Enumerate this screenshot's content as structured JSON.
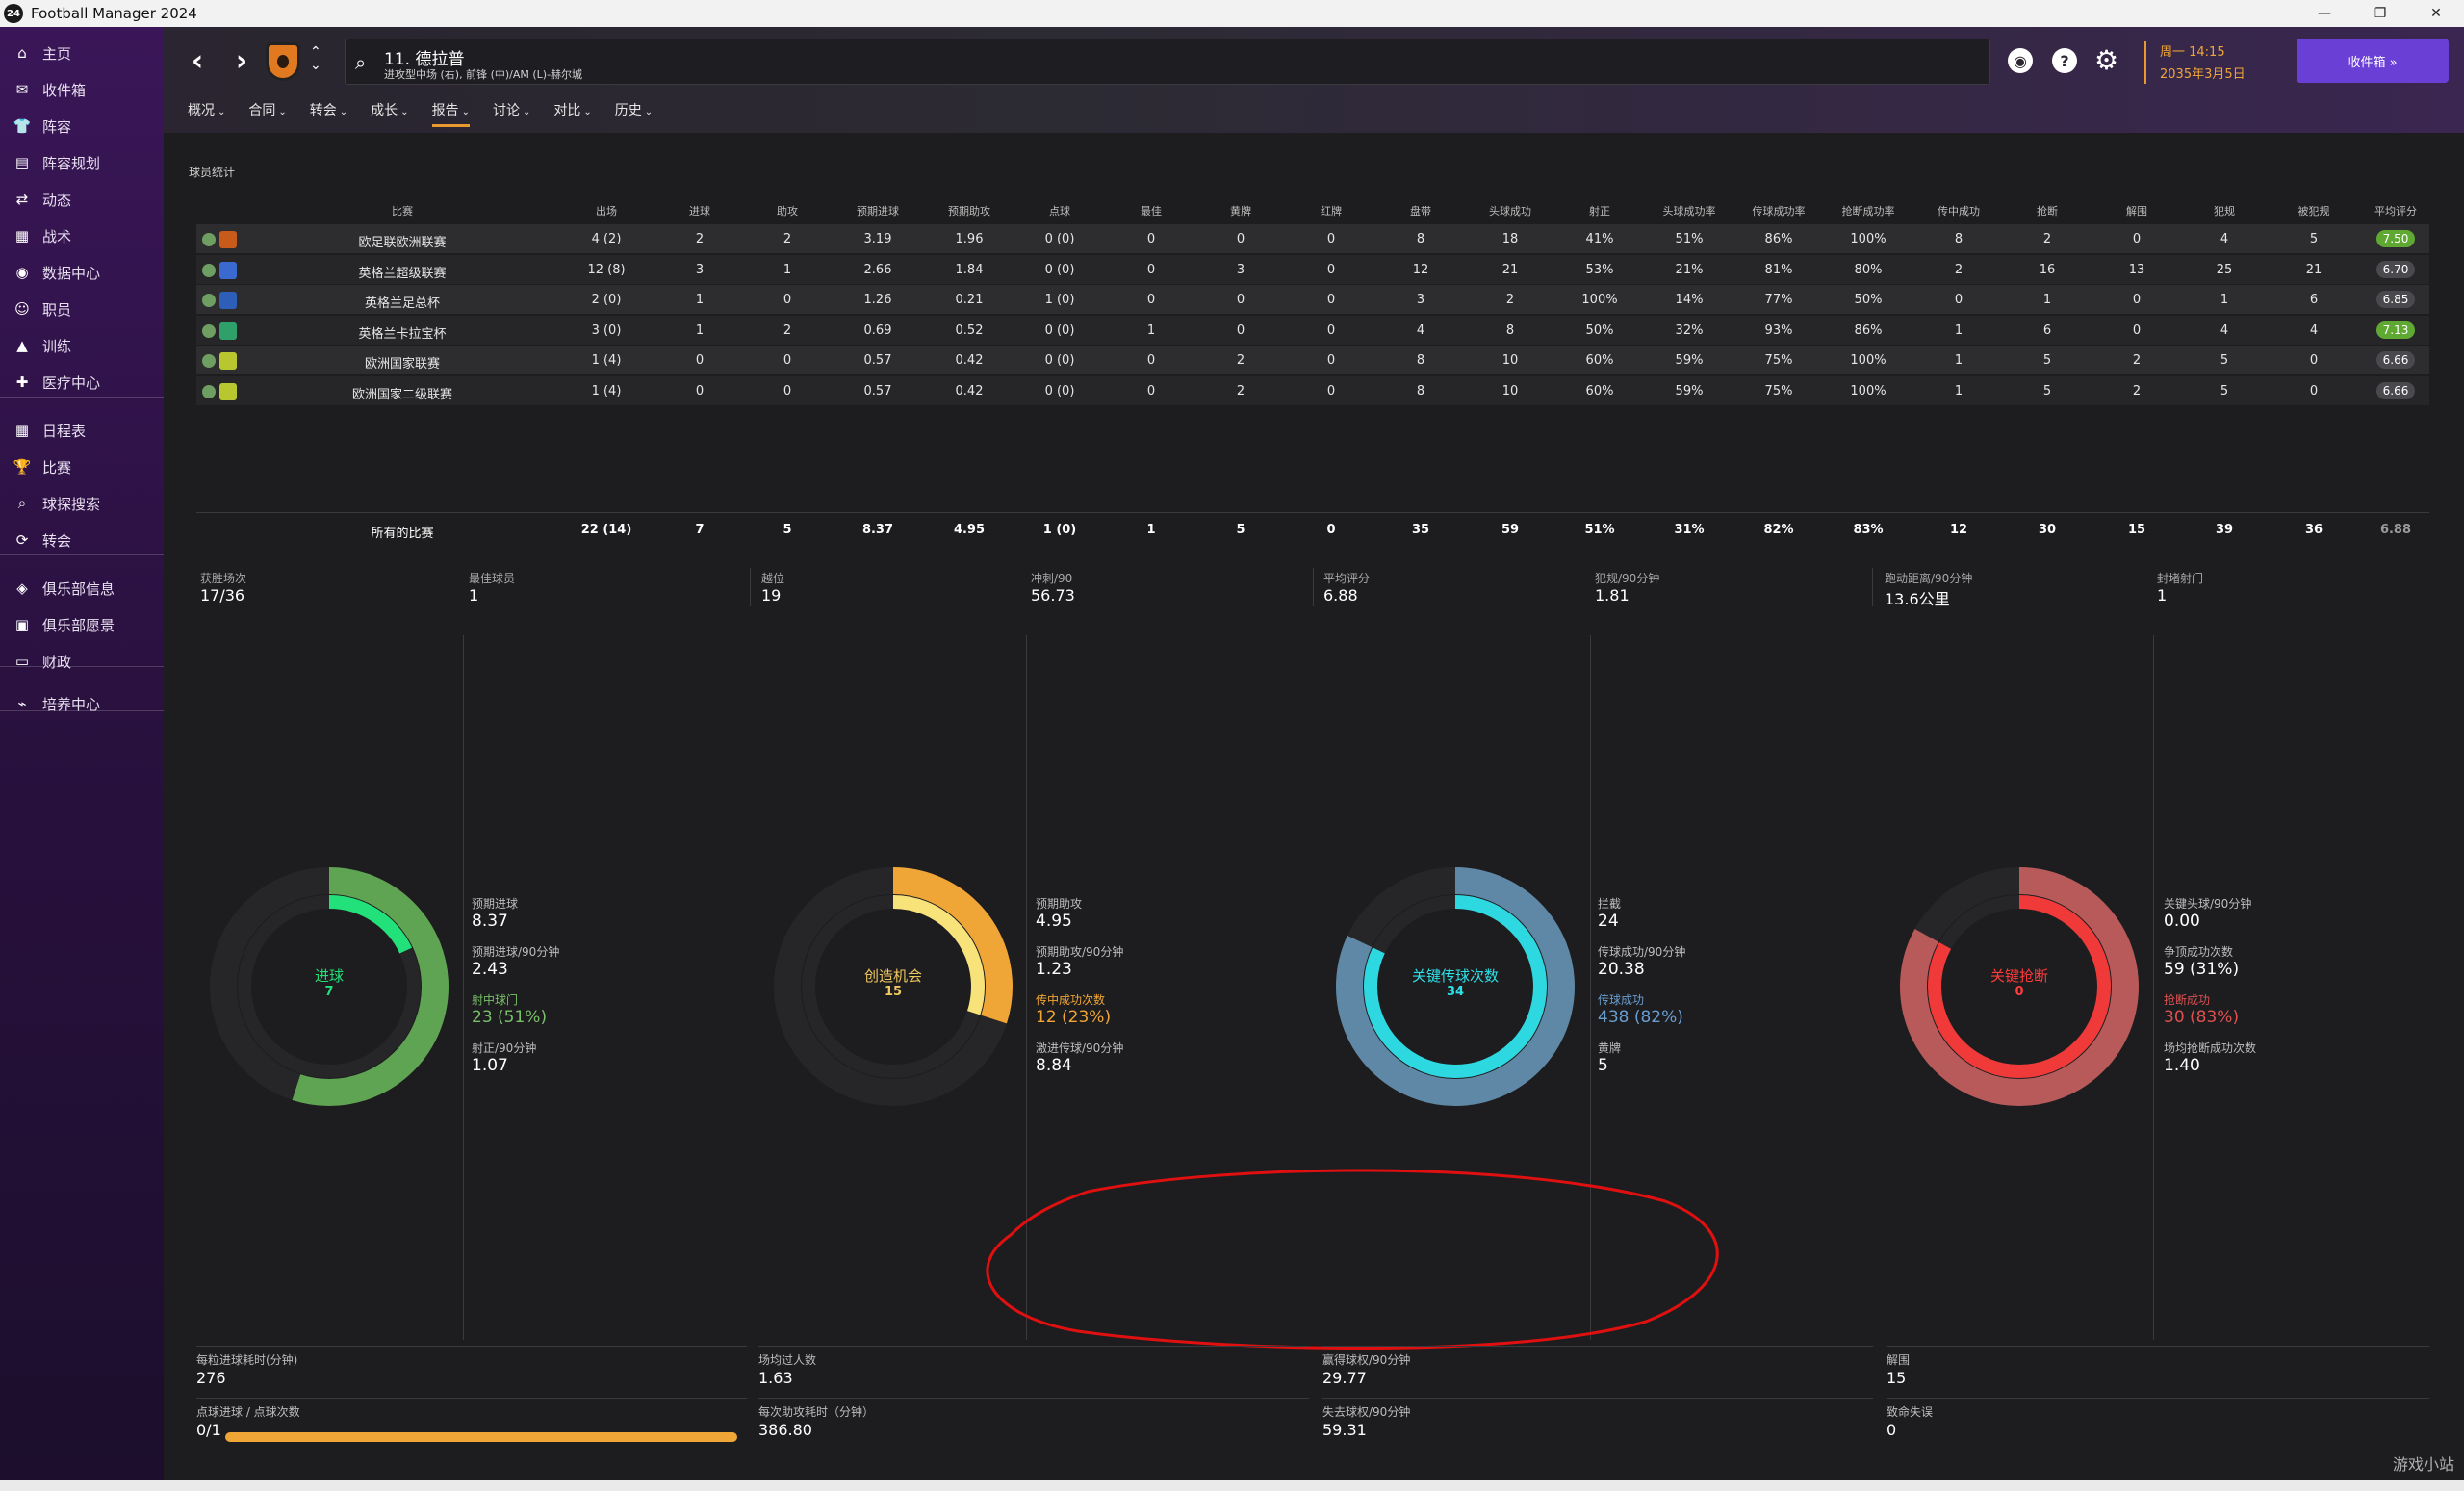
{
  "window": {
    "app_icon": "24",
    "title": "Football Manager 2024",
    "minimize": "—",
    "restore": "❐",
    "close": "✕"
  },
  "sidebar": {
    "items": [
      {
        "label": "主页",
        "icon": "home-icon",
        "glyph": "⌂"
      },
      {
        "label": "收件箱",
        "icon": "inbox-icon",
        "glyph": "✉"
      },
      {
        "label": "阵容",
        "icon": "shirt-icon",
        "glyph": "👕"
      },
      {
        "label": "阵容规划",
        "icon": "clipboard-icon",
        "glyph": "▤"
      },
      {
        "label": "动态",
        "icon": "dynamics-icon",
        "glyph": "⇄"
      },
      {
        "label": "战术",
        "icon": "tactics-icon",
        "glyph": "▦"
      },
      {
        "label": "数据中心",
        "icon": "data-hub-icon",
        "glyph": "◉"
      },
      {
        "label": "职员",
        "icon": "staff-icon",
        "glyph": "☺"
      },
      {
        "label": "训练",
        "icon": "training-icon",
        "glyph": "▲"
      },
      {
        "label": "医疗中心",
        "icon": "medical-icon",
        "glyph": "✚"
      },
      {
        "label": "日程表",
        "icon": "calendar-icon",
        "glyph": "▦"
      },
      {
        "label": "比赛",
        "icon": "trophy-icon",
        "glyph": "🏆"
      },
      {
        "label": "球探搜索",
        "icon": "scouting-icon",
        "glyph": "⌕"
      },
      {
        "label": "转会",
        "icon": "transfer-icon",
        "glyph": "⟳"
      },
      {
        "label": "俱乐部信息",
        "icon": "club-info-icon",
        "glyph": "◈"
      },
      {
        "label": "俱乐部愿景",
        "icon": "club-vision-icon",
        "glyph": "▣"
      },
      {
        "label": "财政",
        "icon": "finance-icon",
        "glyph": "▭"
      },
      {
        "label": "培养中心",
        "icon": "development-icon",
        "glyph": "⌁"
      }
    ]
  },
  "header": {
    "player_name": "11. 德拉普",
    "player_role": "进攻型中场 (右), 前锋 (中)/AM (L)-赫尔城",
    "date_line1": "周一 14:15",
    "date_line2": "2035年3月5日",
    "inbox_button": "收件箱 »",
    "help_glyph": "?",
    "gear_glyph": "⚙"
  },
  "tabs": [
    {
      "label": "概况"
    },
    {
      "label": "合同"
    },
    {
      "label": "转会"
    },
    {
      "label": "成长"
    },
    {
      "label": "报告",
      "active": true
    },
    {
      "label": "讨论"
    },
    {
      "label": "对比"
    },
    {
      "label": "历史"
    }
  ],
  "section_title": "球员统计",
  "table": {
    "columns": [
      "比赛",
      "出场",
      "进球",
      "助攻",
      "预期进球",
      "预期助攻",
      "点球",
      "最佳",
      "黄牌",
      "红牌",
      "盘带",
      "头球成功",
      "射正",
      "头球成功率",
      "传球成功率",
      "抢断成功率",
      "传中成功",
      "抢断",
      "解围",
      "犯规",
      "被犯规",
      "平均评分"
    ],
    "rows": [
      {
        "comp": "欧足联欧洲联赛",
        "icon_color": "#c85a1a",
        "cells": [
          "4 (2)",
          "2",
          "2",
          "3.19",
          "1.96",
          "0 (0)",
          "0",
          "0",
          "0",
          "8",
          "18",
          "41%",
          "51%",
          "86%",
          "100%",
          "8",
          "2",
          "0",
          "4",
          "5"
        ],
        "rating": "7.50",
        "rating_color": "#5fa832"
      },
      {
        "comp": "英格兰超级联赛",
        "icon_color": "#3a6ad0",
        "cells": [
          "12 (8)",
          "3",
          "1",
          "2.66",
          "1.84",
          "0 (0)",
          "0",
          "3",
          "0",
          "12",
          "21",
          "53%",
          "21%",
          "81%",
          "80%",
          "2",
          "16",
          "13",
          "25",
          "21"
        ],
        "rating": "6.70",
        "rating_color": "#4a4a4e"
      },
      {
        "comp": "英格兰足总杯",
        "icon_color": "#2d5fb8",
        "cells": [
          "2 (0)",
          "1",
          "0",
          "1.26",
          "0.21",
          "1 (0)",
          "0",
          "0",
          "0",
          "3",
          "2",
          "100%",
          "14%",
          "77%",
          "50%",
          "0",
          "1",
          "0",
          "1",
          "6"
        ],
        "rating": "6.85",
        "rating_color": "#4a4a4e"
      },
      {
        "comp": "英格兰卡拉宝杯",
        "icon_color": "#2fa06a",
        "cells": [
          "3 (0)",
          "1",
          "2",
          "0.69",
          "0.52",
          "0 (0)",
          "1",
          "0",
          "0",
          "4",
          "8",
          "50%",
          "32%",
          "93%",
          "86%",
          "1",
          "6",
          "0",
          "4",
          "4"
        ],
        "rating": "7.13",
        "rating_color": "#5fa832"
      },
      {
        "comp": "欧洲国家联赛",
        "icon_color": "#b8c630",
        "cells": [
          "1 (4)",
          "0",
          "0",
          "0.57",
          "0.42",
          "0 (0)",
          "0",
          "2",
          "0",
          "8",
          "10",
          "60%",
          "59%",
          "75%",
          "100%",
          "1",
          "5",
          "2",
          "5",
          "0"
        ],
        "rating": "6.66",
        "rating_color": "#4a4a4e"
      },
      {
        "comp": "欧洲国家二级联赛",
        "icon_color": "#b8c630",
        "cells": [
          "1 (4)",
          "0",
          "0",
          "0.57",
          "0.42",
          "0 (0)",
          "0",
          "2",
          "0",
          "8",
          "10",
          "60%",
          "59%",
          "75%",
          "100%",
          "1",
          "5",
          "2",
          "5",
          "0"
        ],
        "rating": "6.66",
        "rating_color": "#4a4a4e"
      }
    ],
    "totals": {
      "label": "所有的比赛",
      "cells": [
        "22 (14)",
        "7",
        "5",
        "8.37",
        "4.95",
        "1 (0)",
        "1",
        "5",
        "0",
        "35",
        "59",
        "51%",
        "31%",
        "82%",
        "83%",
        "12",
        "30",
        "15",
        "39",
        "36",
        "6.88"
      ]
    }
  },
  "summary": [
    {
      "label": "获胜场次",
      "value": "17/36"
    },
    {
      "label": "最佳球员",
      "value": "1"
    },
    {
      "label": "越位",
      "value": "19"
    },
    {
      "label": "冲刺/90",
      "value": "56.73"
    },
    {
      "label": "平均评分",
      "value": "6.88"
    },
    {
      "label": "犯规/90分钟",
      "value": "1.81"
    },
    {
      "label": "跑动距离/90分钟",
      "value": "13.6公里"
    },
    {
      "label": "封堵射门",
      "value": "1"
    }
  ],
  "panels": [
    {
      "donut_label": "进球",
      "donut_value": "7",
      "label_color": "#22e07a",
      "outer_color": "#5fa452",
      "inner_color": "#22e07a",
      "outer_fraction": 0.55,
      "inner_fraction": 0.18,
      "stats": [
        {
          "label": "预期进球",
          "value": "8.37"
        },
        {
          "label": "预期进球/90分钟",
          "value": "2.43"
        },
        {
          "label": "射中球门",
          "value": "23 (51%)",
          "color": "#7ac06a"
        },
        {
          "label": "射正/90分钟",
          "value": "1.07"
        }
      ]
    },
    {
      "donut_label": "创造机会",
      "donut_value": "15",
      "label_color": "#f0c860",
      "outer_color": "#f0a636",
      "inner_color": "#f8e27a",
      "outer_fraction": 0.3,
      "inner_fraction": 0.3,
      "stats": [
        {
          "label": "预期助攻",
          "value": "4.95"
        },
        {
          "label": "预期助攻/90分钟",
          "value": "1.23"
        },
        {
          "label": "传中成功次数",
          "value": "12 (23%)",
          "color": "#f0a636"
        },
        {
          "label": "激进传球/90分钟",
          "value": "8.84"
        }
      ]
    },
    {
      "donut_label": "关键传球次数",
      "donut_value": "34",
      "label_color": "#2ee0e8",
      "outer_color": "#5e88a6",
      "inner_color": "#2ed8e0",
      "outer_fraction": 0.82,
      "inner_fraction": 0.82,
      "stats": [
        {
          "label": "拦截",
          "value": "24"
        },
        {
          "label": "传球成功/90分钟",
          "value": "20.38"
        },
        {
          "label": "传球成功",
          "value": "438 (82%)",
          "color": "#6a9ed0"
        },
        {
          "label": "黄牌",
          "value": "5"
        }
      ]
    },
    {
      "donut_label": "关键抢断",
      "donut_value": "0",
      "label_color": "#ff3b3b",
      "outer_color": "#b85a5a",
      "inner_color": "#f03a3a",
      "outer_fraction": 0.83,
      "inner_fraction": 0.83,
      "stats": [
        {
          "label": "关键头球/90分钟",
          "value": "0.00"
        },
        {
          "label": "争顶成功次数",
          "value": "59 (31%)"
        },
        {
          "label": "抢断成功",
          "value": "30 (83%)",
          "color": "#e05050"
        },
        {
          "label": "场均抢断成功次数",
          "value": "1.40"
        }
      ]
    }
  ],
  "bottom": [
    {
      "label": "每粒进球耗时(分钟)",
      "value": "276"
    },
    {
      "label": "点球进球 / 点球次数",
      "value": "0/1",
      "progress": 1.0
    },
    {
      "label": "场均过人数",
      "value": "1.63"
    },
    {
      "label": "每次助攻耗时（分钟）",
      "value": "386.80"
    },
    {
      "label": "赢得球权/90分钟",
      "value": "29.77"
    },
    {
      "label": "失去球权/90分钟",
      "value": "59.31"
    },
    {
      "label": "解围",
      "value": "15"
    },
    {
      "label": "致命失误",
      "value": "0"
    }
  ],
  "watermark": "游戏小站"
}
